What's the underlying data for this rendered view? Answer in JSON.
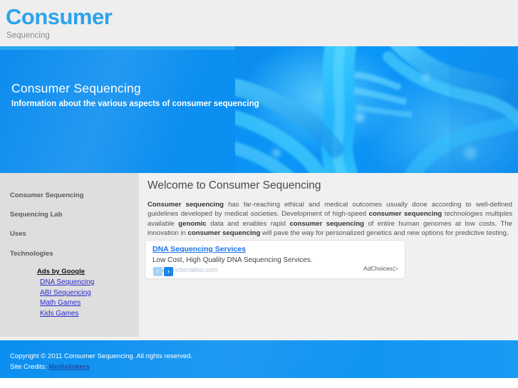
{
  "header": {
    "logo_main": "Consumer",
    "logo_sub": "Sequencing"
  },
  "banner": {
    "title": "Consumer Sequencing",
    "subtitle": "Information about the various aspects of consumer sequencing",
    "image_name": "dna-double-helix-illustration",
    "accent_color": "#0a8ff0"
  },
  "sidebar": {
    "items": [
      {
        "label": "Consumer Sequencing"
      },
      {
        "label": "Sequencing Lab"
      },
      {
        "label": "Uses"
      },
      {
        "label": "Technologies"
      }
    ],
    "ads": {
      "heading": "Ads by Google",
      "links": [
        {
          "label": "DNA Sequencing"
        },
        {
          "label": "ABI Sequencing"
        },
        {
          "label": "Math Games"
        },
        {
          "label": "Kids Games"
        }
      ],
      "link_color": "#2a2ad0"
    }
  },
  "main": {
    "title": "Welcome to Consumer Sequencing",
    "paragraph": {
      "seg1_bold": "Consumer sequencing",
      "seg2": " has far-reaching ethical and medical outcomes usually done according to well-defined guidelines developed by medical societies. Development of high-speed ",
      "seg3_bold": "consumer sequencing",
      "seg4": " technologies multiples available ",
      "seg5_bold": "genomic",
      "seg6": " data and enables rapid ",
      "seg7_bold": "consumer sequencing",
      "seg8": " of entire human genomes at low costs. The innovation in ",
      "seg9_bold": "consumer sequencing",
      "seg10": " will pave the way for personalized genetics and new options for predictive testing."
    }
  },
  "ad_unit": {
    "title": "DNA Sequencing Services",
    "description": "Low Cost, High Quality DNA Sequencing Services.",
    "url": "www.functionalbio.com",
    "prev_icon": "chevron-left-icon",
    "next_icon": "chevron-right-icon",
    "prev_glyph": "‹",
    "next_glyph": "›",
    "adchoices_label": "AdChoices",
    "adchoices_glyph": "▷",
    "title_color": "#1a73e8"
  },
  "footer": {
    "copyright": "Copyright © 2011 Consumer Sequencing. All rights reserved.",
    "credits_prefix": "Site Credits: ",
    "credits_link": "Medialinkers",
    "credits_color": "#1d4ea8"
  }
}
